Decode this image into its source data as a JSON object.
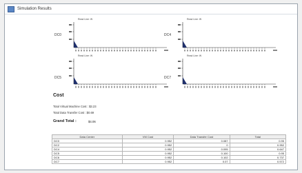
{
  "window": {
    "title": "Simulation Results",
    "icon": "app-window-icon"
  },
  "charts": [
    {
      "id": "DC0",
      "label": "DC0",
      "legend": "Read Line: W"
    },
    {
      "id": "DC4",
      "label": "DC4",
      "legend": "Read Line: W"
    },
    {
      "id": "DC5",
      "label": "DC5",
      "legend": "Read Line: W"
    },
    {
      "id": "DC7",
      "label": "DC7",
      "legend": "Read Line: W"
    }
  ],
  "cost": {
    "title": "Cost",
    "vm_cost_label": "Total Virtual Machine Cost :",
    "vm_cost_value": "$3.23",
    "transfer_cost_label": "Total Data Transfer Cost :",
    "transfer_cost_value": "$0.69",
    "grand_total_label": "Grand Total :",
    "grand_total_value": "$4.06"
  },
  "table": {
    "headers": [
      "Data Center",
      "VM Cost",
      "Data Transfer Cost",
      "Total"
    ],
    "rows": [
      [
        "DC0",
        "0.952",
        "0.087",
        "0.95"
      ],
      [
        "DC2",
        "0.952",
        "0",
        "0.952"
      ],
      [
        "DC4",
        "0.952",
        "0.095",
        "0.647"
      ],
      [
        "DC5",
        "0.952",
        "0.100",
        "0.95"
      ],
      [
        "DC6",
        "0.952",
        "0.102",
        "0.737"
      ],
      [
        "DC7",
        "0.952",
        "0.07",
        "0.572"
      ]
    ]
  }
}
